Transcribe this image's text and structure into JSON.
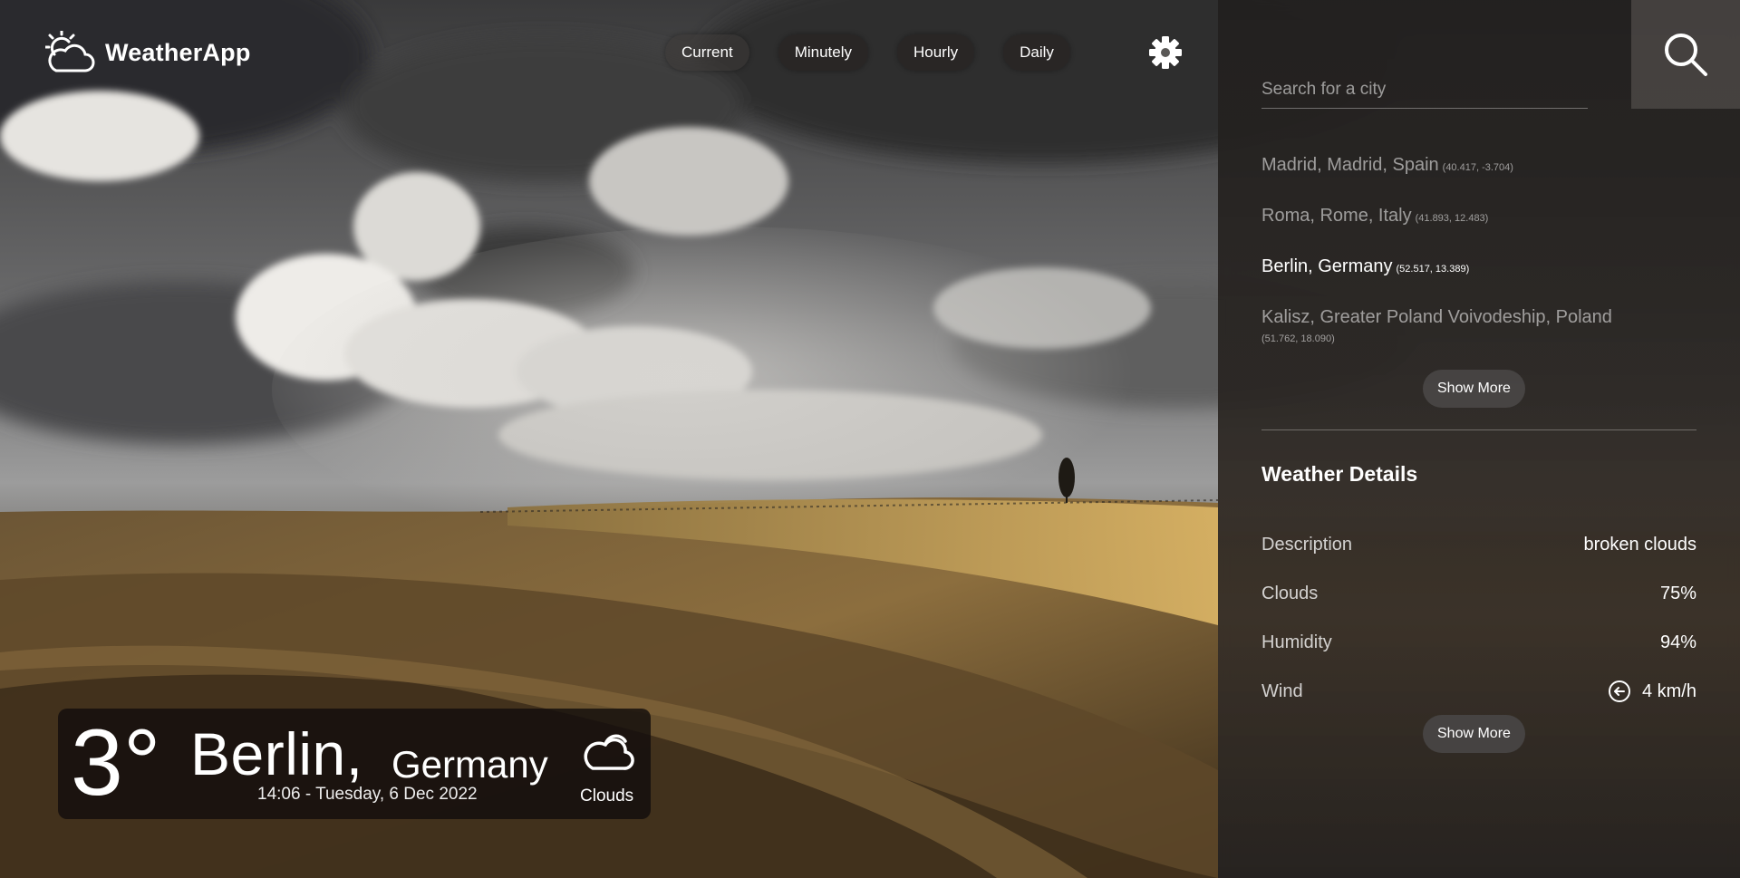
{
  "app": {
    "name": "WeatherApp"
  },
  "nav": {
    "tabs": [
      {
        "label": "Current"
      },
      {
        "label": "Minutely"
      },
      {
        "label": "Hourly"
      },
      {
        "label": "Daily"
      }
    ]
  },
  "current": {
    "temperature": "3°",
    "city": "Berlin,",
    "country": "Germany",
    "datetime": "14:06 - Tuesday, 6 Dec 2022",
    "condition": "Clouds",
    "condition_icon": "cloud-icon"
  },
  "search": {
    "placeholder": "Search for a city"
  },
  "cities": [
    {
      "name": "Madrid, Madrid, Spain",
      "coords": "(40.417, -3.704)"
    },
    {
      "name": "Roma, Rome, Italy",
      "coords": "(41.893, 12.483)"
    },
    {
      "name": "Berlin, Germany",
      "coords": "(52.517, 13.389)"
    },
    {
      "name": "Kalisz, Greater Poland Voivodeship, Poland",
      "coords": "(51.762, 18.090)"
    }
  ],
  "buttons": {
    "show_more": "Show More"
  },
  "details": {
    "title": "Weather Details",
    "rows": [
      {
        "label": "Description",
        "value": "broken clouds"
      },
      {
        "label": "Clouds",
        "value": "75%"
      },
      {
        "label": "Humidity",
        "value": "94%"
      },
      {
        "label": "Wind",
        "value": "4 km/h"
      }
    ]
  },
  "colors": {
    "panel": "#242120",
    "card": "#120e0c",
    "pill": "#484644",
    "hill_light": "#c8a25a",
    "hill_dark": "#3a2c1a"
  }
}
